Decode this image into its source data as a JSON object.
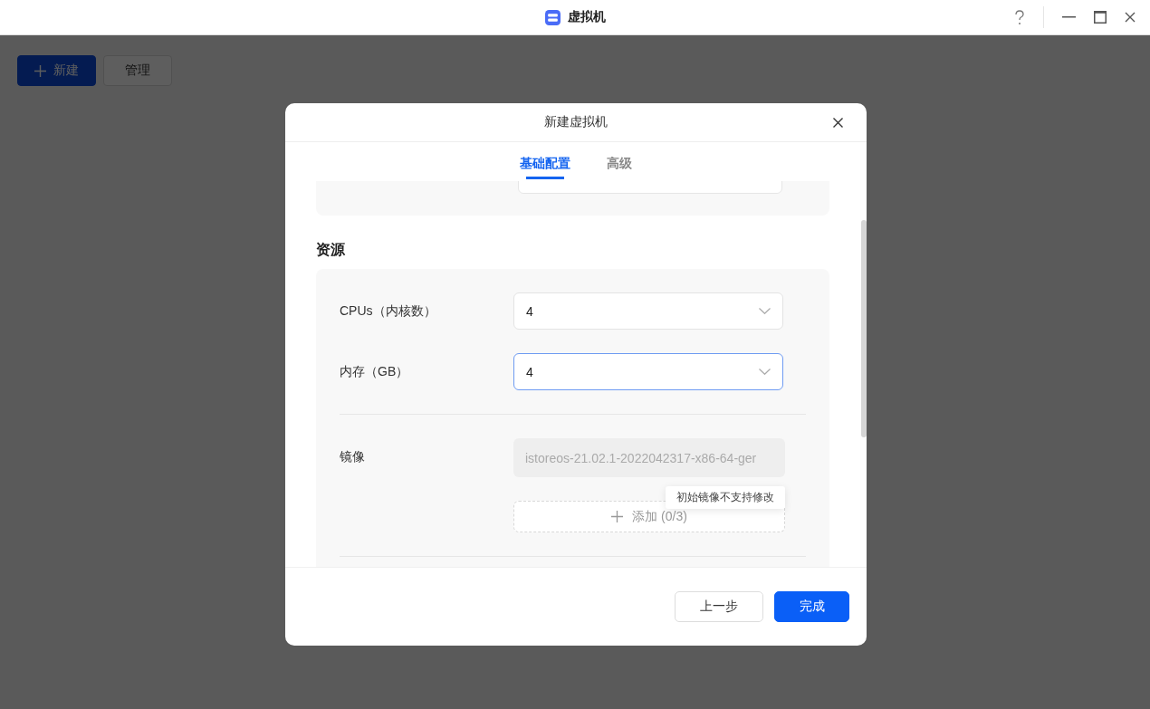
{
  "window": {
    "title": "虚拟机"
  },
  "toolbar": [
    {
      "label": "新建",
      "kind": "primary"
    },
    {
      "label": "管理",
      "kind": "default"
    }
  ],
  "dialog": {
    "title": "新建虚拟机",
    "tabs": [
      {
        "label": "基础配置",
        "selected": true
      },
      {
        "label": "高级",
        "selected": false
      }
    ],
    "section": "资源",
    "fields": [
      {
        "kind": "select",
        "label": "CPUs（内核数）",
        "value": "4",
        "focused": false
      },
      {
        "kind": "select",
        "label": "内存（GB）",
        "value": "4",
        "focused": true
      },
      {
        "kind": "image",
        "label": "镜像",
        "value": "istoreos-21.02.1-2022042317-x86-64-ger",
        "add_label": "添加 (0/3)",
        "tooltip": "初始镜像不支持修改"
      }
    ],
    "buttons": [
      {
        "label": "上一步",
        "kind": "default"
      },
      {
        "label": "完成",
        "kind": "primary"
      }
    ]
  }
}
